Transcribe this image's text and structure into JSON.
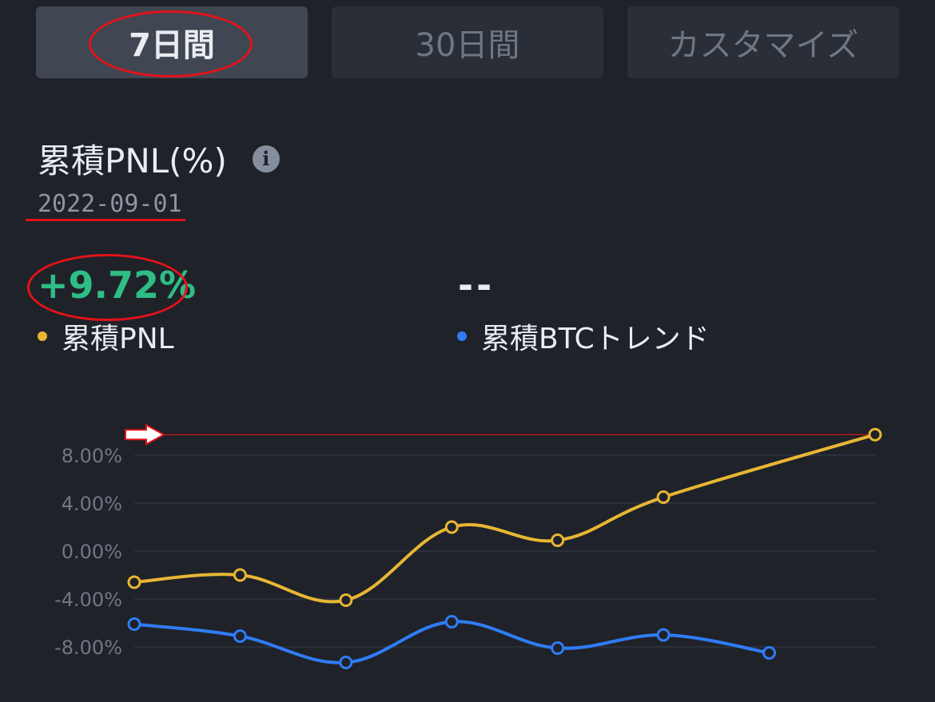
{
  "tabs": [
    {
      "label": "7日間",
      "active": true
    },
    {
      "label": "30日間",
      "active": false
    },
    {
      "label": "カスタマイズ",
      "active": false
    }
  ],
  "header": {
    "title": "累積PNL(%)",
    "info_icon": "info-circle-icon",
    "date": "2022-09-01"
  },
  "summary": {
    "pnl_value": "+9.72%",
    "btc_value": "--"
  },
  "legend": {
    "pnl_label": "累積PNL",
    "btc_label": "累積BTCトレンド"
  },
  "colors": {
    "background": "#1f2229",
    "pnl_series": "#e8b634",
    "btc_series": "#2f7cf6",
    "positive": "#2ebd85",
    "annotation": "#e3121a"
  },
  "annotations": {
    "marker_icon": "arrow-right-icon",
    "circled_items": [
      "7日間",
      "+9.72%"
    ],
    "underlined_items": [
      "2022-09-01"
    ]
  },
  "chart_data": {
    "type": "line",
    "x": [
      1,
      2,
      3,
      4,
      5,
      6,
      7,
      8
    ],
    "series": [
      {
        "name": "累積PNL",
        "values": [
          -2.6,
          -2.0,
          -4.1,
          2.0,
          0.9,
          4.5,
          null,
          9.72
        ]
      },
      {
        "name": "累積BTCトレンド",
        "values": [
          -6.1,
          -7.1,
          -9.3,
          -5.9,
          -8.1,
          -7.0,
          -8.5,
          null
        ]
      }
    ],
    "yticks": [
      8,
      4,
      0,
      -4,
      -8
    ],
    "ytick_labels": [
      "8.00%",
      "4.00%",
      "0.00%",
      "-4.00%",
      "-8.00%"
    ],
    "ylim": [
      -9.5,
      10
    ],
    "grid": true,
    "reference_line": 9.72
  }
}
